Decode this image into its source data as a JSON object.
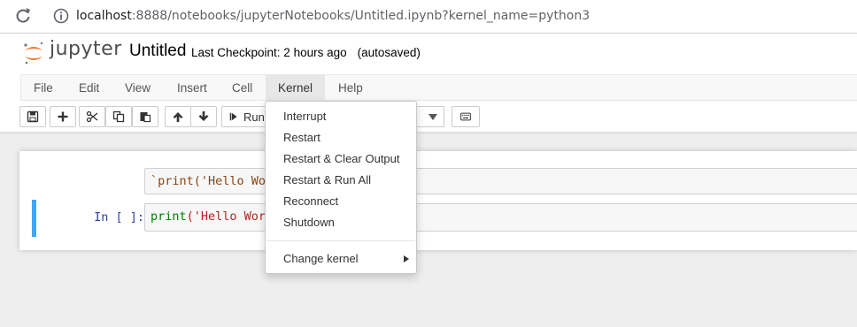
{
  "browser": {
    "url_host": "localhost",
    "url_path": ":8888/notebooks/jupyterNotebooks/Untitled.ipynb?kernel_name=python3"
  },
  "header": {
    "logo_text": "jupyter",
    "notebook_title": "Untitled",
    "checkpoint": "Last Checkpoint: 2 hours ago",
    "autosave": "(autosaved)"
  },
  "menu": {
    "items": [
      "File",
      "Edit",
      "View",
      "Insert",
      "Cell",
      "Kernel",
      "Help"
    ],
    "active": "Kernel"
  },
  "toolbar": {
    "run_label": "Run",
    "icons": [
      "save-icon",
      "plus-icon",
      "cut-icon",
      "copy-icon",
      "paste-icon",
      "arrow-up-icon",
      "arrow-down-icon",
      "step-forward-icon",
      "caret-down-icon",
      "keyboard-icon"
    ]
  },
  "cells": [
    {
      "prompt": "",
      "code": "`print('Hello Wo"
    },
    {
      "prompt": "In [ ]:",
      "code_fn": "print",
      "code_rest": "('Hello Wor"
    }
  ],
  "kernel_menu": {
    "items": [
      "Interrupt",
      "Restart",
      "Restart & Clear Output",
      "Restart & Run All",
      "Reconnect",
      "Shutdown"
    ],
    "submenu": "Change kernel"
  },
  "colors": {
    "accent_orange": "#f37726",
    "prompt_blue": "#303f9f",
    "selected_cell_border": "#42a5f5"
  }
}
